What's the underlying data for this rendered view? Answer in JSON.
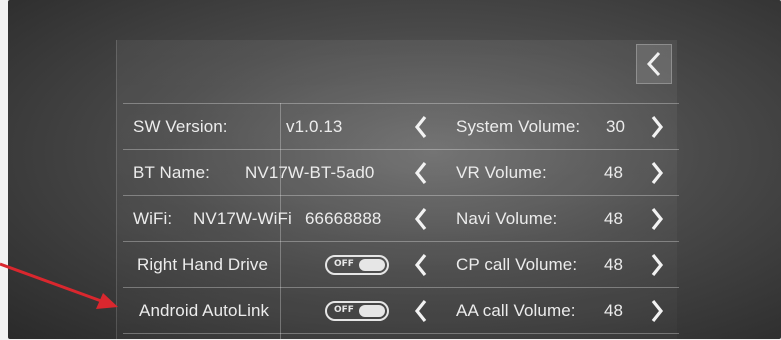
{
  "header": {
    "back_icon": "chevron-left-icon"
  },
  "info": {
    "sw_version_label": "SW Version:",
    "sw_version_value": "v1.0.13",
    "bt_name_label": "BT Name:",
    "bt_name_value": "NV17W-BT-5ad0",
    "wifi_label": "WiFi:",
    "wifi_value": "NV17W-WiFi",
    "wifi_password": "66668888",
    "rhd_label": "Right Hand Drive",
    "rhd_toggle": "OFF",
    "autolink_label": "Android AutoLink",
    "autolink_toggle": "OFF"
  },
  "volumes": [
    {
      "label": "System Volume:",
      "value": "30"
    },
    {
      "label": "VR Volume:",
      "value": "48"
    },
    {
      "label": "Navi Volume:",
      "value": "48"
    },
    {
      "label": "CP call Volume:",
      "value": "48"
    },
    {
      "label": "AA call Volume:",
      "value": "48"
    }
  ],
  "colors": {
    "text": "#ececec",
    "annotation_arrow": "#d9272e"
  }
}
